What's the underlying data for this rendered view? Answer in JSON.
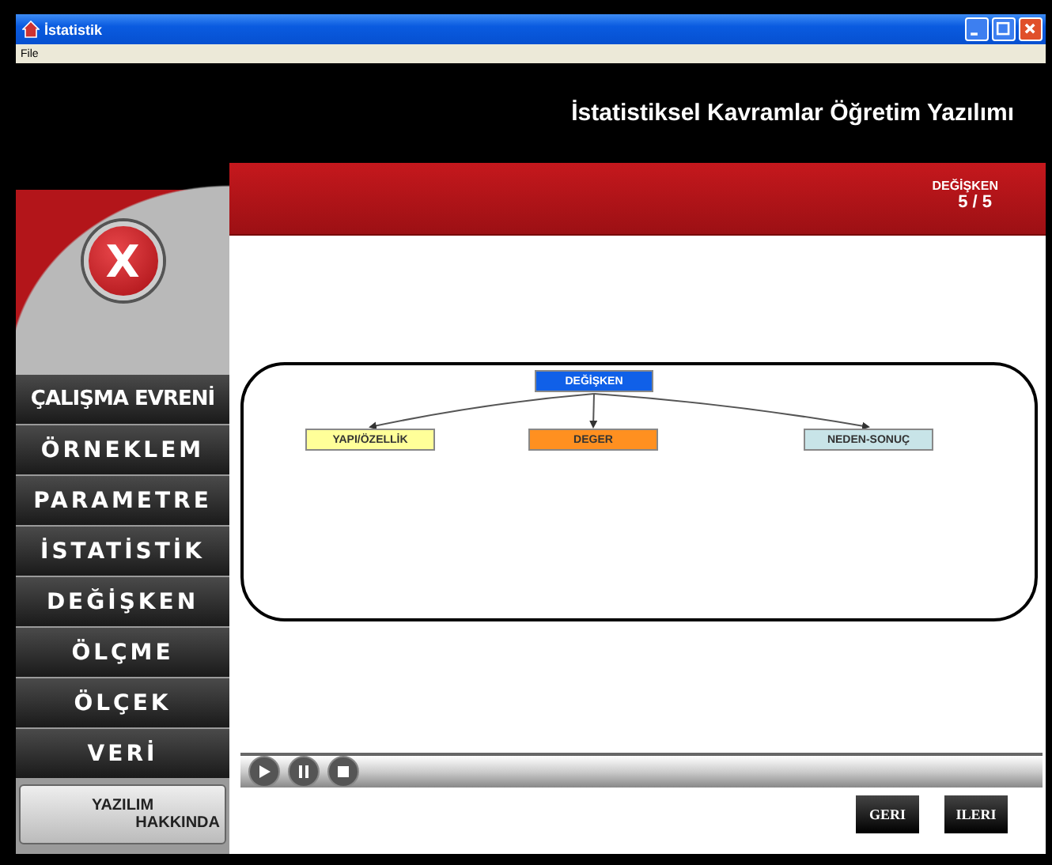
{
  "window": {
    "title": "İstatistik"
  },
  "menu": [
    "File"
  ],
  "header": {
    "title": "İstatistiksel Kavramlar Öğretim Yazılımı",
    "section": "DEĞİŞKEN",
    "page": "5 / 5"
  },
  "sidebar": {
    "close_label": "X",
    "items": [
      "ÇALIŞMA EVRENİ",
      "ÖRNEKLEM",
      "PARAMETRE",
      "İSTATİSTİK",
      "DEĞİŞKEN",
      "ÖLÇME",
      "ÖLÇEK",
      "VERİ"
    ],
    "about": [
      "YAZILIM",
      "HAKKINDA"
    ]
  },
  "diagram": {
    "root": {
      "label": "DEĞİŞKEN",
      "color": "#1060e8"
    },
    "children": [
      {
        "label": "YAPI/ÖZELLİK",
        "color": "#ffff99"
      },
      {
        "label": "DEGER",
        "color": "#ff9020"
      },
      {
        "label": "NEDEN-SONUÇ",
        "color": "#c8e4e8"
      }
    ]
  },
  "player": {
    "controls": [
      {
        "kind": "play"
      },
      {
        "kind": "pause"
      },
      {
        "kind": "stop"
      }
    ]
  },
  "nav_buttons": [
    "GERI",
    "ILERI"
  ]
}
